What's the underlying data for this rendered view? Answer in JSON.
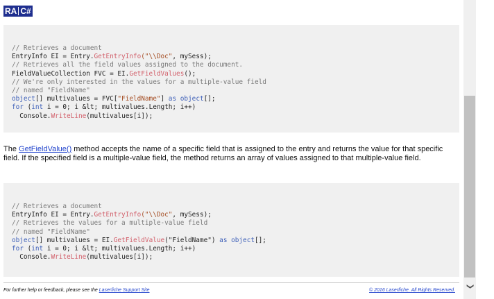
{
  "language_tabs": [
    "RA",
    "C#"
  ],
  "code_block_1": [
    [
      {
        "t": "// Retrieves a document",
        "c": "cm"
      }
    ],
    [
      {
        "t": "EntryInfo EI = Entry.",
        "c": ""
      },
      {
        "t": "GetEntryInfo",
        "c": "fn"
      },
      {
        "t": "(\"\\\\Doc\"",
        "c": "st"
      },
      {
        "t": ", mySess);",
        "c": ""
      }
    ],
    [
      {
        "t": "// Retrieves all the field values assigned to the document.",
        "c": "cm"
      }
    ],
    [
      {
        "t": "FieldValueCollection FVC = EI.",
        "c": ""
      },
      {
        "t": "GetFieldValues",
        "c": "fn"
      },
      {
        "t": "();",
        "c": ""
      }
    ],
    [
      {
        "t": "// We're only interested in the values for a multiple-value field",
        "c": "cm"
      }
    ],
    [
      {
        "t": "// named \"FieldName\"",
        "c": "cm"
      }
    ],
    [
      {
        "t": "object",
        "c": "kw"
      },
      {
        "t": "[] multivalues = FVC[",
        "c": ""
      },
      {
        "t": "\"FieldName\"",
        "c": "st"
      },
      {
        "t": "] ",
        "c": ""
      },
      {
        "t": "as",
        "c": "kw"
      },
      {
        "t": " ",
        "c": ""
      },
      {
        "t": "object",
        "c": "kw"
      },
      {
        "t": "[];",
        "c": ""
      }
    ],
    [
      {
        "t": "for",
        "c": "kw"
      },
      {
        "t": " (",
        "c": ""
      },
      {
        "t": "int",
        "c": "kw"
      },
      {
        "t": " i = 0; i &lt; multivalues.Length; i++)",
        "c": ""
      }
    ],
    [
      {
        "t": "  Console.",
        "c": ""
      },
      {
        "t": "WriteLine",
        "c": "fn"
      },
      {
        "t": "(multivalues[i]);",
        "c": ""
      }
    ]
  ],
  "description": {
    "pre": "The ",
    "link": "GetFieldValue()",
    "post": " method accepts the name of a specific field that is assigned to the entry and returns the value for that specific field. If the specified field is a multiple-value field, the method returns an array of values assigned to that multiple-value field."
  },
  "code_block_2": [
    [
      {
        "t": "// Retrieves a document",
        "c": "cm"
      }
    ],
    [
      {
        "t": "EntryInfo EI = Entry.",
        "c": ""
      },
      {
        "t": "GetEntryInfo",
        "c": "fn"
      },
      {
        "t": "(\"\\\\Doc\"",
        "c": "st"
      },
      {
        "t": ", mySess);",
        "c": ""
      }
    ],
    [
      {
        "t": "// Retrieves the values for a multiple-value field",
        "c": "cm"
      }
    ],
    [
      {
        "t": "// named \"FieldName\"",
        "c": "cm"
      }
    ],
    [
      {
        "t": "object",
        "c": "kw"
      },
      {
        "t": "[] multivalues = EI.",
        "c": ""
      },
      {
        "t": "GetFieldValue",
        "c": "fn"
      },
      {
        "t": "(\"FieldName\") ",
        "c": ""
      },
      {
        "t": "as",
        "c": "kw"
      },
      {
        "t": " ",
        "c": ""
      },
      {
        "t": "object",
        "c": "kw"
      },
      {
        "t": "[];",
        "c": ""
      }
    ],
    [
      {
        "t": "for",
        "c": "kw"
      },
      {
        "t": " (",
        "c": ""
      },
      {
        "t": "int",
        "c": "kw"
      },
      {
        "t": " i = 0; i &lt; multivalues.Length; i++)",
        "c": ""
      }
    ],
    [
      {
        "t": "  Console.",
        "c": ""
      },
      {
        "t": "WriteLine",
        "c": "fn"
      },
      {
        "t": "(multivalues[i]);",
        "c": ""
      }
    ]
  ],
  "footer": {
    "help_text": "For further help or feedback, please see the ",
    "help_link": "Laserfiche Support Site",
    "copyright": "© 2016 Laserfiche. All Rights Reserved."
  },
  "scrollbar": {
    "down_arrow": "❯"
  }
}
